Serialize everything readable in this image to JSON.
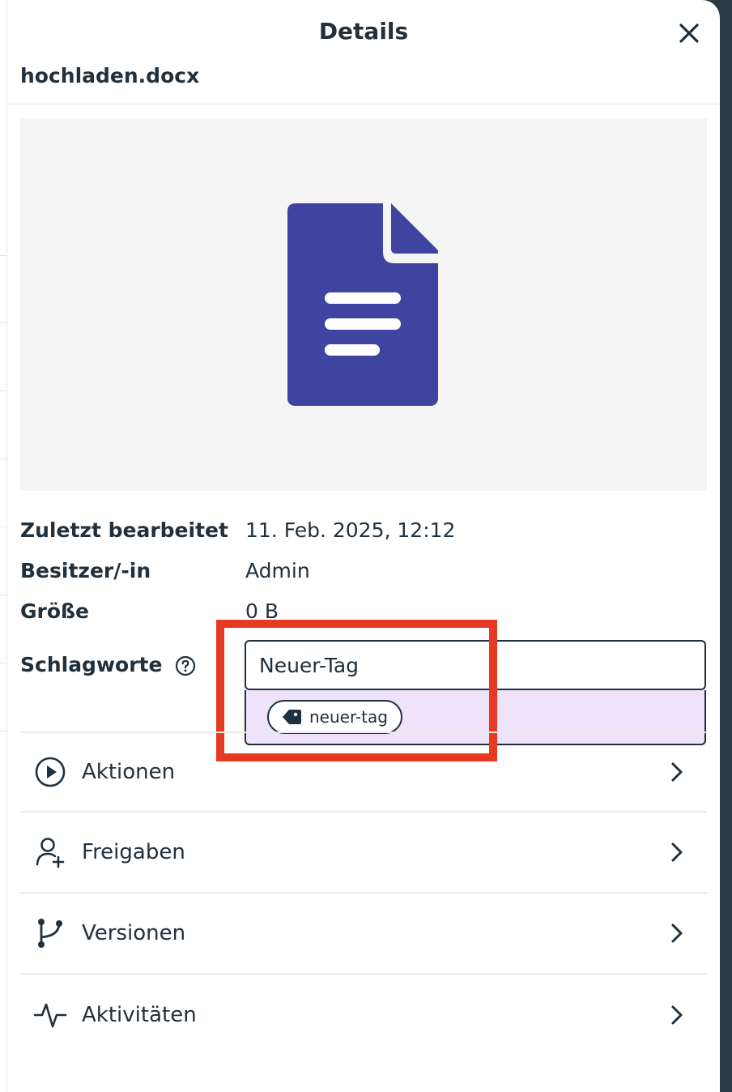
{
  "panel": {
    "title": "Details",
    "filename": "hochladen.docx"
  },
  "details": {
    "modified_label": "Zuletzt bearbeitet",
    "modified_value": "11. Feb. 2025, 12:12",
    "owner_label": "Besitzer/-in",
    "owner_value": "Admin",
    "size_label": "Größe",
    "size_value": "0 B",
    "tags_label": "Schlagworte"
  },
  "tags": {
    "input_value": "Neuer-Tag",
    "suggestion": "neuer-tag"
  },
  "nav": [
    {
      "label": "Aktionen",
      "icon": "play-circle-icon"
    },
    {
      "label": "Freigaben",
      "icon": "user-plus-icon"
    },
    {
      "label": "Versionen",
      "icon": "git-branch-icon"
    },
    {
      "label": "Aktivitäten",
      "icon": "activity-icon"
    }
  ],
  "colors": {
    "doc_icon": "#3f44a0",
    "highlight": "#e63a22",
    "suggestion_bg": "#efe3fb",
    "text": "#20303c"
  }
}
